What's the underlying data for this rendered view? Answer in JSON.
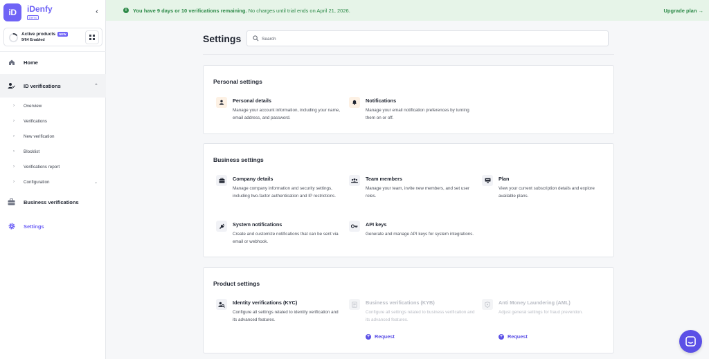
{
  "brand": {
    "name": "iDenfy",
    "tag": "Demo",
    "logo_text": "iD"
  },
  "sidebar": {
    "products": {
      "title": "Active products",
      "badge": "NEW",
      "subtitle": "9/64 Enabled",
      "enabled_fraction": 0.14
    },
    "nav": {
      "home": "Home",
      "id_verifications": "ID verifications",
      "business_verifications": "Business verifications",
      "settings": "Settings"
    },
    "sub_items": [
      "Overview",
      "Verifications",
      "New verification",
      "Blocklist",
      "Verifications report",
      "Configuration"
    ]
  },
  "banner": {
    "strong_text": "You have 9 days or 10 verifications remaining.",
    "rest_text": " No charges until trial ends on April 21, 2026.",
    "action": "Upgrade plan →"
  },
  "header": {
    "title": "Settings",
    "search_placeholder": "Search"
  },
  "personal": {
    "title": "Personal settings",
    "items": [
      {
        "title": "Personal details",
        "desc": "Manage your account information, including your name, email address, and password."
      },
      {
        "title": "Notifications",
        "desc": "Manage your email notification preferences by turning them on or off."
      }
    ]
  },
  "business": {
    "title": "Business settings",
    "items": [
      {
        "title": "Company details",
        "desc": "Manage company information and security settings, including two-factor authentication and IP restrictions."
      },
      {
        "title": "Team members",
        "desc": "Manage your team, invite new members, and set user roles."
      },
      {
        "title": "Plan",
        "desc": "View your current subscription details and explore available plans."
      },
      {
        "title": "System notifications",
        "desc": "Create and customize notifications that can be sent via email or webhook."
      },
      {
        "title": "API keys",
        "desc": "Generate and manage API keys for system integrations."
      }
    ]
  },
  "product": {
    "title": "Product settings",
    "items": [
      {
        "title": "Identity verifications (KYC)",
        "desc": "Configure all settings related to identity verification and its advanced features."
      },
      {
        "title": "Business verifications (KYB)",
        "desc": "Configure all settings related to business verification and its advanced features."
      },
      {
        "title": "Anti Money Laundering (AML)",
        "desc": "Adjust general settings for fraud prevention."
      }
    ],
    "request_label": "Request"
  },
  "colors": {
    "accent": "#6f63f6",
    "banner_bg": "#e6f4e8",
    "banner_text": "#2d8a48"
  }
}
